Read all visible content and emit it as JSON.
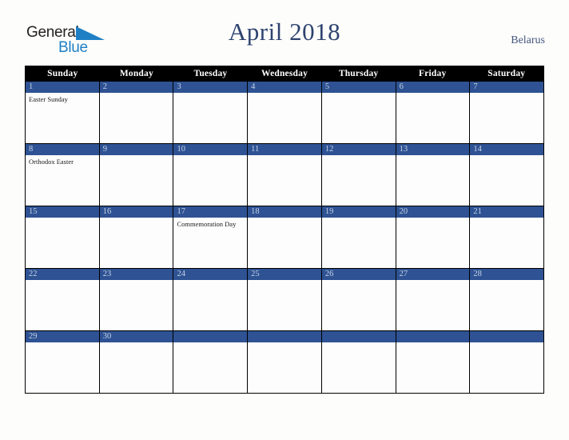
{
  "brand": {
    "name_part1": "General",
    "name_part2": "Blue",
    "triangle_icon": "triangle-icon",
    "color_dark": "#231f20",
    "color_blue": "#1f7fc4"
  },
  "header": {
    "title": "April 2018",
    "country": "Belarus",
    "title_color": "#2e436f",
    "country_color": "#44567f"
  },
  "calendar": {
    "accent_color": "#2e5293",
    "weekday_header_bg": "#000000",
    "weekday_header_color": "#ffffff",
    "weekdays": [
      "Sunday",
      "Monday",
      "Tuesday",
      "Wednesday",
      "Thursday",
      "Friday",
      "Saturday"
    ],
    "weeks": [
      [
        {
          "day": "1",
          "event": "Easter Sunday"
        },
        {
          "day": "2",
          "event": ""
        },
        {
          "day": "3",
          "event": ""
        },
        {
          "day": "4",
          "event": ""
        },
        {
          "day": "5",
          "event": ""
        },
        {
          "day": "6",
          "event": ""
        },
        {
          "day": "7",
          "event": ""
        }
      ],
      [
        {
          "day": "8",
          "event": "Orthodox Easter"
        },
        {
          "day": "9",
          "event": ""
        },
        {
          "day": "10",
          "event": ""
        },
        {
          "day": "11",
          "event": ""
        },
        {
          "day": "12",
          "event": ""
        },
        {
          "day": "13",
          "event": ""
        },
        {
          "day": "14",
          "event": ""
        }
      ],
      [
        {
          "day": "15",
          "event": ""
        },
        {
          "day": "16",
          "event": ""
        },
        {
          "day": "17",
          "event": "Commemoration Day"
        },
        {
          "day": "18",
          "event": ""
        },
        {
          "day": "19",
          "event": ""
        },
        {
          "day": "20",
          "event": ""
        },
        {
          "day": "21",
          "event": ""
        }
      ],
      [
        {
          "day": "22",
          "event": ""
        },
        {
          "day": "23",
          "event": ""
        },
        {
          "day": "24",
          "event": ""
        },
        {
          "day": "25",
          "event": ""
        },
        {
          "day": "26",
          "event": ""
        },
        {
          "day": "27",
          "event": ""
        },
        {
          "day": "28",
          "event": ""
        }
      ],
      [
        {
          "day": "29",
          "event": ""
        },
        {
          "day": "30",
          "event": ""
        },
        {
          "day": "",
          "event": ""
        },
        {
          "day": "",
          "event": ""
        },
        {
          "day": "",
          "event": ""
        },
        {
          "day": "",
          "event": ""
        },
        {
          "day": "",
          "event": ""
        }
      ]
    ]
  }
}
